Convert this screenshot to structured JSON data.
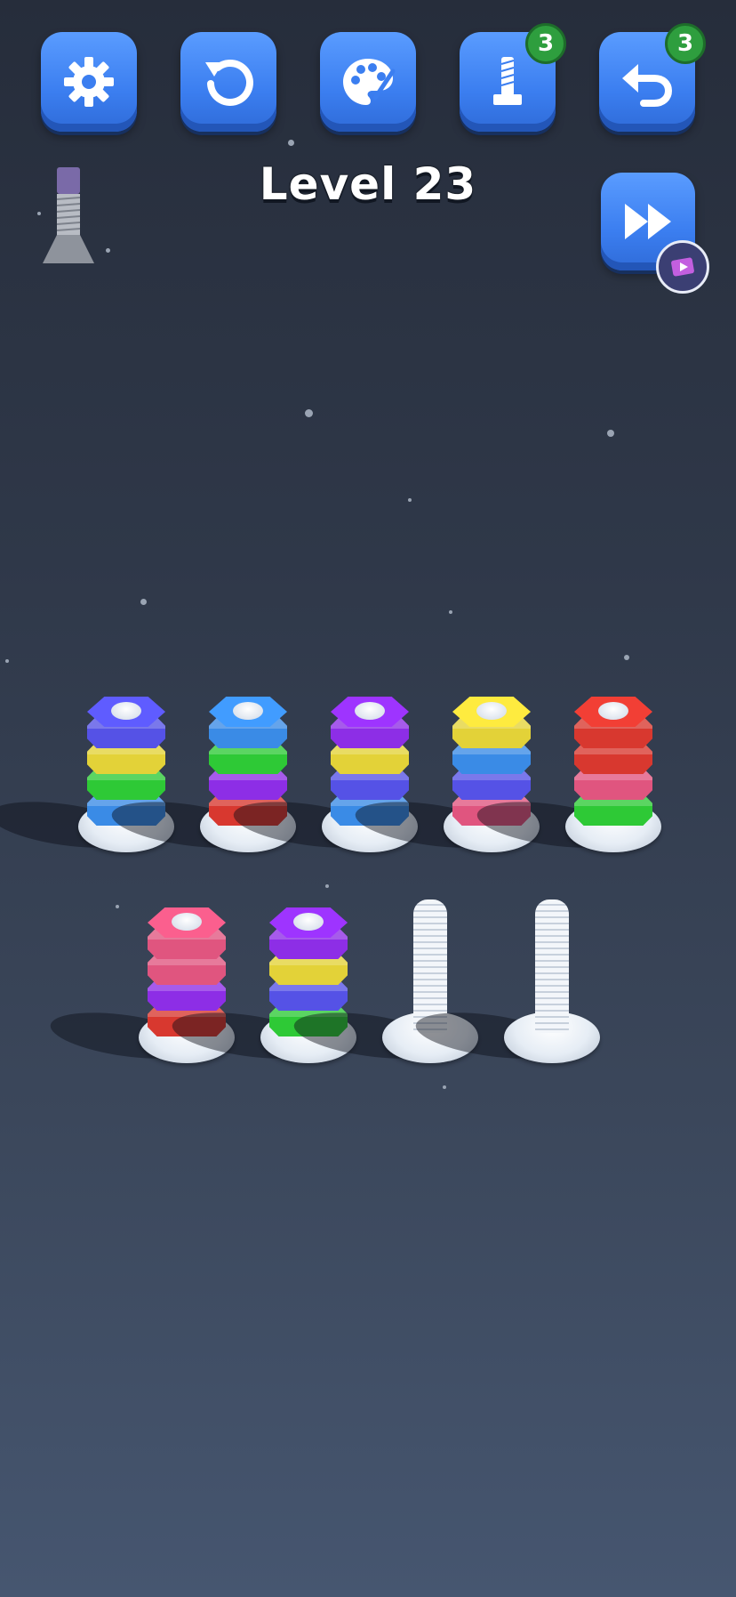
{
  "level_title": "Level 23",
  "toolbar": {
    "settings": {
      "icon": "gear-icon"
    },
    "restart": {
      "icon": "restart-icon"
    },
    "theme": {
      "icon": "palette-icon"
    },
    "extra_bolt": {
      "icon": "bolt-icon",
      "count": "3"
    },
    "undo": {
      "icon": "undo-icon",
      "count": "3"
    }
  },
  "skip_level": {
    "icon": "fast-forward-icon",
    "ad_icon": "video-ad-icon"
  },
  "colors": {
    "blue": "#3a8be6",
    "indigo": "#5552e6",
    "yellow": "#e3d238",
    "green": "#2ec936",
    "purple": "#8d2ee6",
    "red": "#d8382f",
    "pink": "#e0557f",
    "button_blue": "#3b7ef0",
    "badge_green": "#2e9e3e"
  },
  "board": {
    "rows": [
      [
        {
          "nuts": [
            "blue",
            "green",
            "yellow",
            "indigo"
          ]
        },
        {
          "nuts": [
            "red",
            "purple",
            "green",
            "blue"
          ]
        },
        {
          "nuts": [
            "blue",
            "indigo",
            "yellow",
            "purple"
          ]
        },
        {
          "nuts": [
            "pink",
            "indigo",
            "blue",
            "yellow"
          ]
        },
        {
          "nuts": [
            "green",
            "pink",
            "red",
            "red"
          ]
        }
      ],
      [
        {
          "nuts": [
            "red",
            "purple",
            "pink",
            "pink"
          ]
        },
        {
          "nuts": [
            "green",
            "indigo",
            "yellow",
            "purple"
          ]
        },
        {
          "nuts": []
        },
        {
          "nuts": []
        }
      ]
    ]
  }
}
